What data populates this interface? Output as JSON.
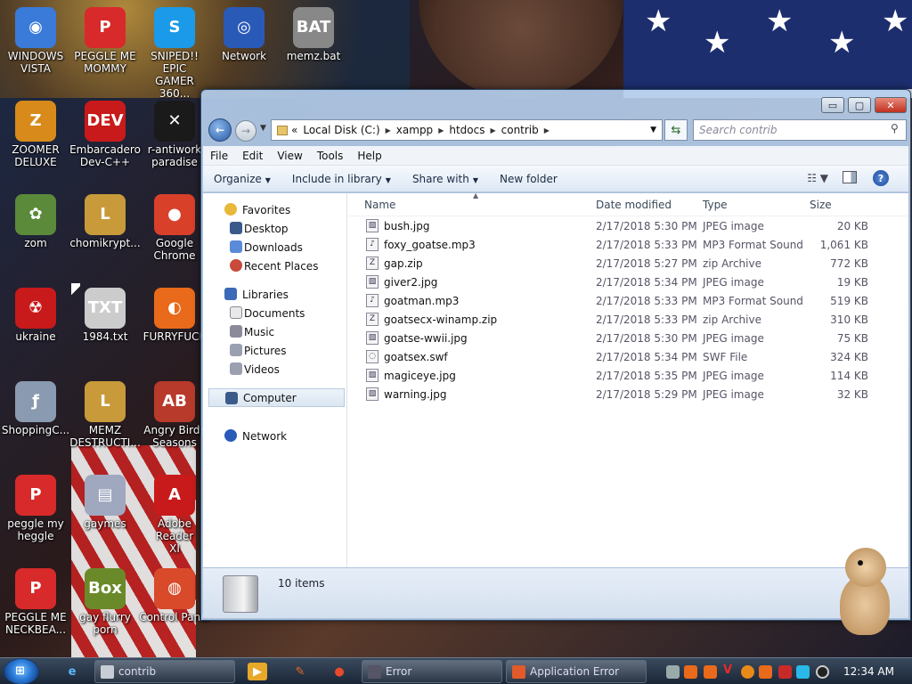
{
  "desktop": {
    "icons": [
      {
        "label": "WINDOWS\nVISTA",
        "glyph": "◉",
        "color": "#3a7ad8"
      },
      {
        "label": "PEGGLE ME\nMOMMY",
        "glyph": "P",
        "color": "#d82a2a"
      },
      {
        "label": "SNIPED!! EPIC\nGAMER 360...",
        "glyph": "S",
        "color": "#1a9ae8"
      },
      {
        "label": "Network",
        "glyph": "◎",
        "color": "#2a5ab8"
      },
      {
        "label": "memz.bat",
        "glyph": "BAT",
        "color": "#888"
      },
      {
        "label": "ZOOMER\nDELUXE",
        "glyph": "Z",
        "color": "#d88a1a"
      },
      {
        "label": "Embarcadero\nDev-C++",
        "glyph": "DEV",
        "color": "#c81a1a"
      },
      {
        "label": "r-antiwork\nparadise",
        "glyph": "✕",
        "color": "#1a1a1a"
      },
      {
        "label": "zom",
        "glyph": "✿",
        "color": "#5a8a3a"
      },
      {
        "label": "chomikrypt...",
        "glyph": "L",
        "color": "#c89a3a"
      },
      {
        "label": "Google\nChrome",
        "glyph": "●",
        "color": "#d8402a"
      },
      {
        "label": "ukraine",
        "glyph": "☢",
        "color": "#c81a1a"
      },
      {
        "label": "1984.txt",
        "glyph": "TXT",
        "color": "#ccc"
      },
      {
        "label": "FURRYFUCK",
        "glyph": "◐",
        "color": "#e86a1a"
      },
      {
        "label": "ShoppingC...",
        "glyph": "ƒ",
        "color": "#8a9ab0"
      },
      {
        "label": "MEMZ\nDESTRUCTI...",
        "glyph": "L",
        "color": "#c89a3a"
      },
      {
        "label": "Angry Birds\nSeasons",
        "glyph": "AB",
        "color": "#b83a2a"
      },
      {
        "label": "peggle my\nheggle",
        "glyph": "P",
        "color": "#d82a2a"
      },
      {
        "label": "gaymes",
        "glyph": "▤",
        "color": "#a0a8c0"
      },
      {
        "label": "Adobe Reader\nXI",
        "glyph": "A",
        "color": "#c81a1a"
      },
      {
        "label": "PEGGLE ME\nNECKBEA...",
        "glyph": "P",
        "color": "#d82a2a"
      },
      {
        "label": "gay flurry\nporn",
        "glyph": "Box",
        "color": "#6a8a2a"
      },
      {
        "label": "Control Panel",
        "glyph": "◍",
        "color": "#d84a2a"
      }
    ]
  },
  "window": {
    "title": "",
    "controls": {
      "minimize": "▭",
      "maximize": "▢",
      "close": "✕"
    },
    "address": {
      "prefix": "«",
      "segments": [
        "Local Disk (C:)",
        "xampp",
        "htdocs",
        "contrib"
      ]
    },
    "search_placeholder": "Search contrib",
    "menu": [
      "File",
      "Edit",
      "View",
      "Tools",
      "Help"
    ],
    "toolbar": [
      "Organize",
      "Include in library",
      "Share with",
      "New folder"
    ],
    "nav": {
      "favorites_header": "Favorites",
      "favorites": [
        "Desktop",
        "Downloads",
        "Recent Places"
      ],
      "libraries_header": "Libraries",
      "libraries": [
        "Documents",
        "Music",
        "Pictures",
        "Videos"
      ],
      "computer": "Computer",
      "network": "Network"
    },
    "columns": {
      "name": "Name",
      "date": "Date modified",
      "type": "Type",
      "size": "Size"
    },
    "files": [
      {
        "name": "bush.jpg",
        "date": "2/17/2018 5:30 PM",
        "type": "JPEG image",
        "size": "20 KB",
        "icon": "img"
      },
      {
        "name": "foxy_goatse.mp3",
        "date": "2/17/2018 5:33 PM",
        "type": "MP3 Format Sound",
        "size": "1,061 KB",
        "icon": "snd"
      },
      {
        "name": "gap.zip",
        "date": "2/17/2018 5:27 PM",
        "type": "zip Archive",
        "size": "772 KB",
        "icon": "zip"
      },
      {
        "name": "giver2.jpg",
        "date": "2/17/2018 5:34 PM",
        "type": "JPEG image",
        "size": "19 KB",
        "icon": "img"
      },
      {
        "name": "goatman.mp3",
        "date": "2/17/2018 5:33 PM",
        "type": "MP3 Format Sound",
        "size": "519 KB",
        "icon": "snd"
      },
      {
        "name": "goatsecx-winamp.zip",
        "date": "2/17/2018 5:33 PM",
        "type": "zip Archive",
        "size": "310 KB",
        "icon": "zip"
      },
      {
        "name": "goatse-wwii.jpg",
        "date": "2/17/2018 5:30 PM",
        "type": "JPEG image",
        "size": "75 KB",
        "icon": "img"
      },
      {
        "name": "goatsex.swf",
        "date": "2/17/2018 5:34 PM",
        "type": "SWF File",
        "size": "324 KB",
        "icon": "swf"
      },
      {
        "name": "magiceye.jpg",
        "date": "2/17/2018 5:35 PM",
        "type": "JPEG image",
        "size": "114 KB",
        "icon": "img"
      },
      {
        "name": "warning.jpg",
        "date": "2/17/2018 5:29 PM",
        "type": "JPEG image",
        "size": "32 KB",
        "icon": "img"
      }
    ],
    "status": "10 items"
  },
  "taskbar": {
    "tasks": [
      {
        "label": "contrib",
        "color": "#c8ccd4"
      },
      {
        "label": "Error",
        "color": "#556"
      },
      {
        "label": "Application Error",
        "color": "#e05a2a"
      }
    ],
    "clock": "12:34 AM"
  },
  "colors": {
    "accent": "#2a5aa8",
    "taskbar": "#1a2636"
  }
}
